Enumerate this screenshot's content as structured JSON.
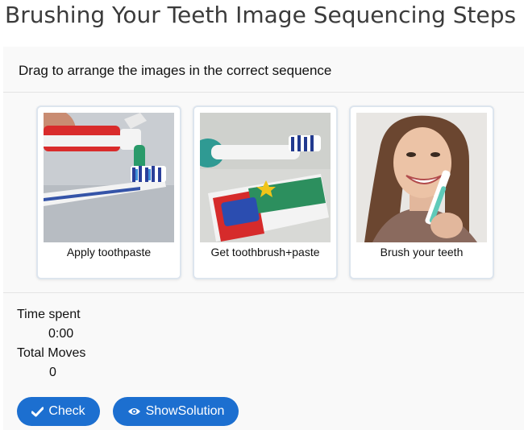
{
  "page": {
    "title": "Brushing Your Teeth Image Sequencing Steps"
  },
  "activity": {
    "instruction": "Drag to arrange the images in the correct sequence",
    "cards": [
      {
        "caption": "Apply toothpaste",
        "image": "toothpaste-on-brush-photo"
      },
      {
        "caption": "Get toothbrush+paste",
        "image": "toothbrush-and-tube-photo"
      },
      {
        "caption": "Brush your teeth",
        "image": "woman-brushing-teeth-photo"
      }
    ]
  },
  "stats": {
    "time_label": "Time spent",
    "time_value": "0:00",
    "moves_label": "Total Moves",
    "moves_value": "0"
  },
  "buttons": {
    "check_label": "Check",
    "check_icon": "checkmark-icon",
    "solution_label": "ShowSolution",
    "solution_icon": "eye-icon"
  },
  "colors": {
    "button_blue": "#1c6fd0",
    "panel_bg": "#f9f9f9",
    "card_border": "#dde5ee"
  }
}
